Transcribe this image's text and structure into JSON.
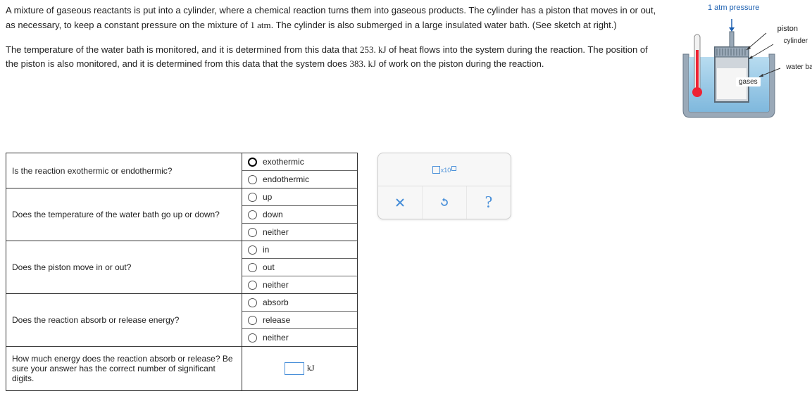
{
  "para1_a": "A mixture of gaseous reactants is put into a cylinder, where a chemical reaction turns them into gaseous products. The cylinder has a piston that moves in or out, as necessary, to keep a constant pressure on the mixture of ",
  "para1_math1": "1 atm",
  "para1_b": ". The cylinder is also submerged in a large insulated water bath. (See sketch at right.)",
  "para2_a": "The temperature of the water bath is monitored, and it is determined from this data that ",
  "para2_math1": "253. kJ",
  "para2_b": " of heat flows into the system during the reaction. The position of the piston is also monitored, and it is determined from this data that the system does ",
  "para2_math2": "383. kJ",
  "para2_c": " of work on the piston during the reaction.",
  "diagram": {
    "pressure": "1 atm pressure",
    "piston": "piston",
    "cylinder": "cylinder",
    "waterbath": "water bath",
    "gases": "gases"
  },
  "questions": {
    "q1": "Is the reaction exothermic or endothermic?",
    "q2": "Does the temperature of the water bath go up or down?",
    "q3": "Does the piston move in or out?",
    "q4": "Does the reaction absorb or release energy?",
    "q5": "How much energy does the reaction absorb or release? Be sure your answer has the correct number of significant digits."
  },
  "options": {
    "q1a": "exothermic",
    "q1b": "endothermic",
    "q2a": "up",
    "q2b": "down",
    "q2c": "neither",
    "q3a": "in",
    "q3b": "out",
    "q3c": "neither",
    "q4a": "absorb",
    "q4b": "release",
    "q4c": "neither"
  },
  "answer_unit": "kJ",
  "tool_sci_sub": "x10"
}
